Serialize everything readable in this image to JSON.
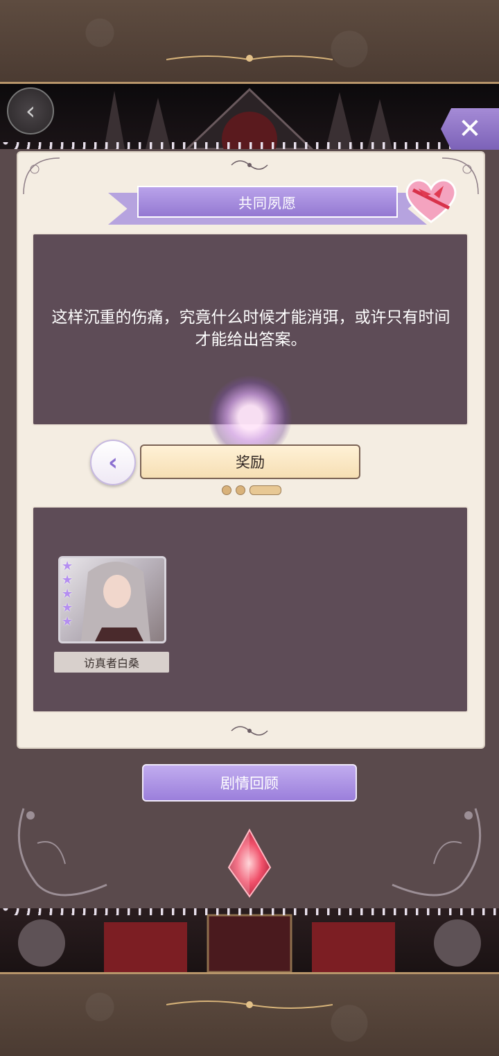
{
  "header": {
    "back_icon": "chevron-left-icon",
    "close_icon": "close-x-icon"
  },
  "dialog": {
    "title": "共同夙愿",
    "story_text": "这样沉重的伤痛，究竟什么时候才能消弭，或许只有时间才能给出答案。",
    "reward_label": "奖励",
    "page_indicator": {
      "count": 3,
      "active_index": 2
    }
  },
  "rewards": [
    {
      "name": "访真者白桑",
      "stars": 5
    }
  ],
  "footer": {
    "review_button": "剧情回顾"
  },
  "colors": {
    "accent_purple": "#9b7fdb",
    "panel_bg": "#f4ede2",
    "dark_box": "#5e4c57",
    "reward_label_bg": "#f6dfb4"
  }
}
